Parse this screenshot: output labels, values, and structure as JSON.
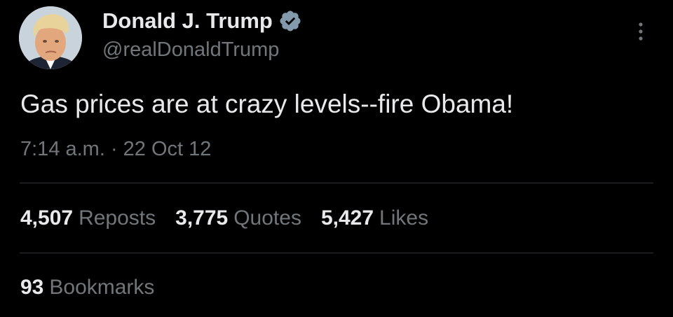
{
  "author": {
    "display_name": "Donald J. Trump",
    "handle": "@realDonaldTrump",
    "verified_icon": "verified-badge-icon",
    "avatar_icon": "profile-photo"
  },
  "tweet": {
    "text": "Gas prices are at crazy levels--fire Obama!",
    "timestamp": "7:14 a.m. · 22 Oct 12"
  },
  "stats": [
    {
      "value": "4,507",
      "label": "Reposts"
    },
    {
      "value": "3,775",
      "label": "Quotes"
    },
    {
      "value": "5,427",
      "label": "Likes"
    }
  ],
  "bookmarks": {
    "value": "93",
    "label": "Bookmarks"
  },
  "menu": {
    "icon": "more-options-icon"
  },
  "colors": {
    "background": "#000000",
    "primary_text": "#e7e9ea",
    "secondary_text": "#71767b",
    "divider": "#2f3336",
    "verified": "#829aab"
  }
}
